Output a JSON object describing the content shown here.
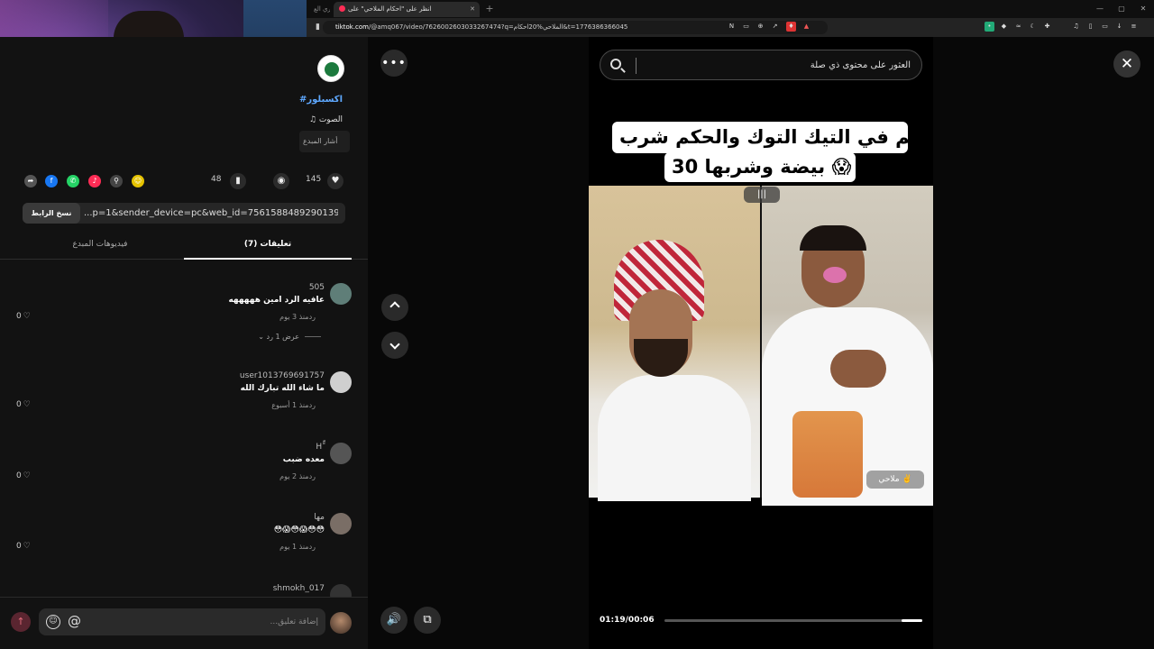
{
  "browser": {
    "other_tab_label": "مختاري الع",
    "active_tab_title": "انظر على \"احكام الملاحي\" على",
    "url_host": "tiktok.com",
    "url_path": "/@amq067/video/7626002603033267474?q=الملاحي%20احكام&t=1776386366045"
  },
  "left_panel": {
    "hashtag_text": "#اكسبلور",
    "sound_text": "♫ الصوت",
    "mention_text": "أشار المبدع",
    "stats": {
      "likes": "145",
      "comments": "48"
    },
    "copy_link_label": "نسخ الرابط",
    "link_text": "...p=1&sender_device=pc&web_id=7561588489290139147",
    "tabs": {
      "comments": "(7) تعليقات",
      "creator_videos": "فيديوهات المبدع"
    },
    "comments": [
      {
        "user": "505",
        "text": "عافيه الرد امين هههههه",
        "time": "منذ 3 يوم",
        "reply": "رد",
        "likes": "0",
        "avatar_color": "#5f7e78",
        "view_replies": "عرض 1 رد"
      },
      {
        "user": "user1013769691757",
        "text": "ما شاء الله تبارك الله",
        "time": "منذ 1 أسبوع",
        "reply": "رد",
        "likes": "0",
        "avatar_color": "#cfcfcf"
      },
      {
        "user": "H ٍّ",
        "text": "معده ضبب",
        "time": "منذ 2 يوم",
        "reply": "رد",
        "likes": "0",
        "avatar_color": "#555555"
      },
      {
        "user": "مها",
        "text": "😳😱😳😱😳😳",
        "time": "منذ 1 يوم",
        "reply": "رد",
        "likes": "0",
        "avatar_color": "#7a6e66"
      },
      {
        "user": "shmokh_017",
        "text": "",
        "time": "",
        "reply": "",
        "likes": "",
        "avatar_color": "#333333"
      }
    ],
    "comment_placeholder": "إضافة تعليق...",
    "send_icon": "arrow-up-icon"
  },
  "player": {
    "search_placeholder": "العثور على محتوى ذي صلة",
    "caption_line1": "انحكم في التيك التوك والحكم شرب",
    "caption_line2": "30 بيضة وشربها 😱",
    "badge_text": "ملاحي ✌️",
    "time_text": "01:19/00:06",
    "progress_fraction": 0.08,
    "accent_color": "#fe2c55"
  }
}
